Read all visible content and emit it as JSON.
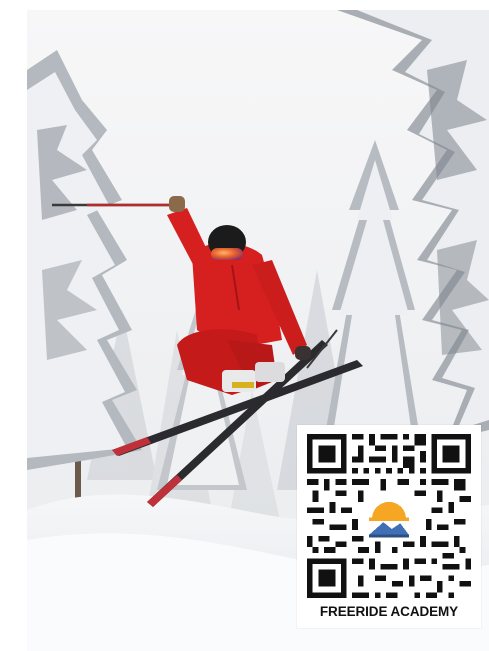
{
  "photo": {
    "subject": "freestyle-skier-jumping",
    "scene": "snowy-pine-forest"
  },
  "qr": {
    "caption": "FREERIDE ACADEMY",
    "logo_icon": "sun-over-mountain-icon"
  },
  "colors": {
    "jacket": "#d61f1f",
    "pants": "#c41a1a",
    "helmet": "#1b1b1b",
    "goggles": "#e8622a",
    "snow": "#f4f5f7",
    "logo_sun": "#f5a623"
  }
}
